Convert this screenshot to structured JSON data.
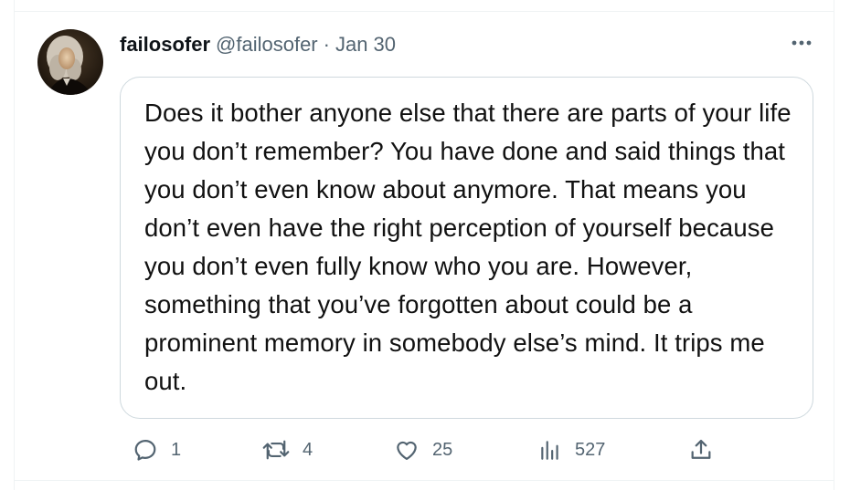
{
  "tweet": {
    "display_name": "failosofer",
    "handle": "@failosofer",
    "separator": "·",
    "date": "Jan 30",
    "text": "Does it bother anyone else that there are parts of your life you don’t remember? You have done and said things that you don’t even know about anymore. That means you don’t even have the right perception of yourself because you don’t even fully know who you are. However, something that you’ve forgotten about could be a prominent memory in somebody else’s mind. It trips me out."
  },
  "actions": {
    "reply": {
      "icon": "reply-icon",
      "count": "1"
    },
    "retweet": {
      "icon": "retweet-icon",
      "count": "4"
    },
    "like": {
      "icon": "heart-icon",
      "count": "25"
    },
    "views": {
      "icon": "views-icon",
      "count": "527"
    },
    "share": {
      "icon": "share-icon"
    }
  },
  "colors": {
    "text_primary": "#0f1419",
    "text_secondary": "#536471",
    "border": "#cfd9de"
  }
}
